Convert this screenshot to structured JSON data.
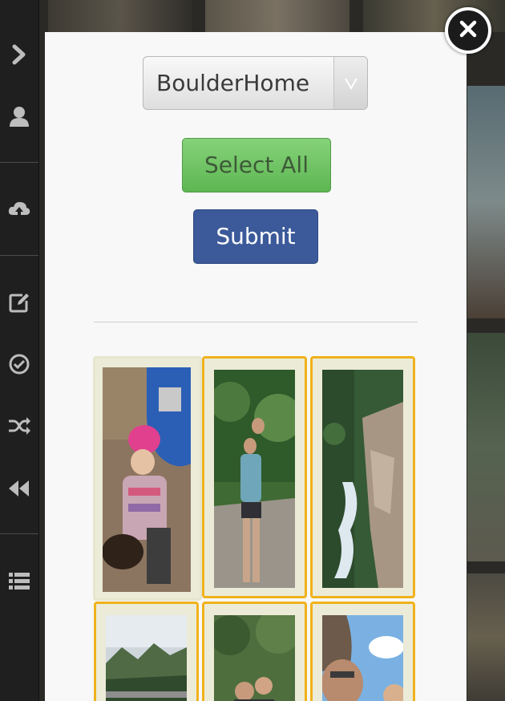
{
  "sidebar": {
    "icons": [
      "chevron-right-icon",
      "user-icon",
      "cloud-upload-icon",
      "edit-icon",
      "check-circle-icon",
      "shuffle-icon",
      "rewind-icon",
      "list-icon"
    ]
  },
  "modal": {
    "album_select": {
      "value": "BoulderHome"
    },
    "select_all_label": "Select All",
    "submit_label": "Submit",
    "colors": {
      "select_all": "#6cc45f",
      "submit": "#3c5a9a",
      "selected_border": "#f0b21b"
    },
    "photos": [
      {
        "subject": "child in pink hat with dog by blue car",
        "selected": false
      },
      {
        "subject": "hiker on forest trail",
        "selected": true
      },
      {
        "subject": "waterfall through rocks",
        "selected": true
      },
      {
        "subject": "mountain landscape with road",
        "selected": true
      },
      {
        "subject": "group of people among trees",
        "selected": true
      },
      {
        "subject": "selfie with sky",
        "selected": true
      }
    ]
  },
  "close_icon": "close-icon"
}
